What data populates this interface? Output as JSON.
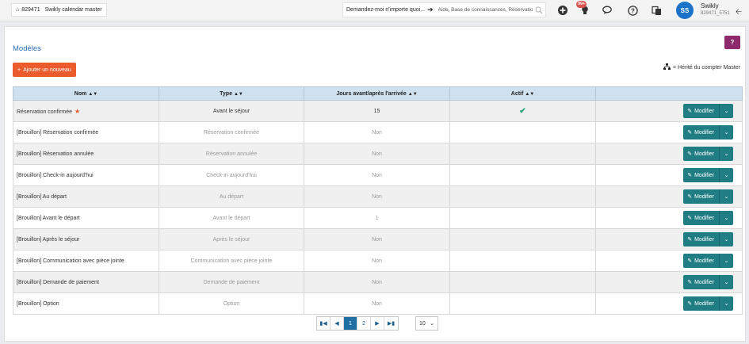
{
  "topbar": {
    "account_id": "829471",
    "account_name": "Swikly calendar master",
    "ask_label": "Demandez-moi n'importe quoi...",
    "search_placeholder": "Aide, Base de connaissances, Réservatio",
    "notification_badge": "99+",
    "user_initials": "SS",
    "user_name": "Swikly",
    "user_id": "829471_5751"
  },
  "page": {
    "title": "Modèles",
    "help_label": "?",
    "add_button": "Ajouter un nouveau",
    "inherit_note": "= Hérité du compter Master"
  },
  "table": {
    "headers": [
      "Nom",
      "Type",
      "Jours avant/après l'arrivée",
      "Actif",
      ""
    ],
    "modify_label": "Modifier",
    "rows": [
      {
        "name": "Réservation confirmée",
        "type": "Avant le séjour",
        "days": "15",
        "active": true,
        "starred": true
      },
      {
        "name": "[Brouillon] Réservation confirmée",
        "type": "Réservation confirmée",
        "days": "Non",
        "active": false,
        "starred": false
      },
      {
        "name": "[Brouillon] Réservation annulée",
        "type": "Réservation annulée",
        "days": "Non",
        "active": false,
        "starred": false
      },
      {
        "name": "[Brouillon] Check-in aujourd'hui",
        "type": "Check-in aujourd'hui",
        "days": "Non",
        "active": false,
        "starred": false
      },
      {
        "name": "[Brouillon] Au départ",
        "type": "Au départ",
        "days": "Non",
        "active": false,
        "starred": false
      },
      {
        "name": "[Brouillon] Avant le départ",
        "type": "Avant le départ",
        "days": "1",
        "active": false,
        "starred": false
      },
      {
        "name": "[Brouillon] Après le séjour",
        "type": "Après le séjour",
        "days": "Non",
        "active": false,
        "starred": false
      },
      {
        "name": "[Brouillon] Communication avec pièce jointe",
        "type": "Communication avec pièce jointe",
        "days": "Non",
        "active": false,
        "starred": false
      },
      {
        "name": "[Brouillon] Demande de paiement",
        "type": "Demande de paiement",
        "days": "Non",
        "active": false,
        "starred": false
      },
      {
        "name": "[Brouillon] Option",
        "type": "Option",
        "days": "Non",
        "active": false,
        "starred": false
      }
    ]
  },
  "pagination": {
    "pages": [
      "1",
      "2"
    ],
    "current_page": "1",
    "per_page": "10"
  },
  "colors": {
    "accent": "#1f7d83",
    "add_button": "#ec5b2e",
    "header_bg": "#cfe0ee",
    "active_check": "#26a37a"
  }
}
